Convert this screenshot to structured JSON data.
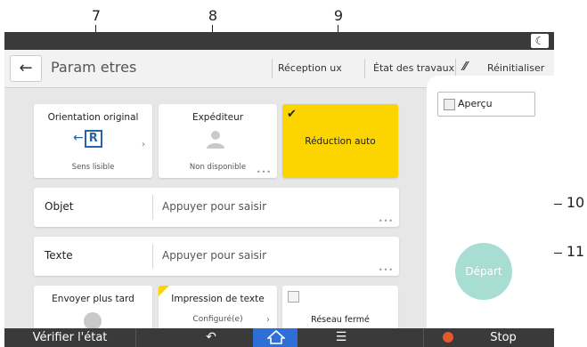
{
  "callouts": {
    "n7": "7",
    "n8": "8",
    "n9": "9",
    "n10": "10",
    "n11": "11"
  },
  "header": {
    "back_glyph": "←",
    "title": "Param etres",
    "reception": "Réception ux",
    "job_status": "État des travaux",
    "reset": "Réinitialiser"
  },
  "tiles": {
    "orientation": {
      "title": "Orientation original",
      "footer": "Sens lisible",
      "icon": "orientation-r-icon"
    },
    "sender": {
      "title": "Expéditeur",
      "footer": "Non disponible",
      "icon": "user-icon"
    },
    "reduction": {
      "label": "Réduction auto",
      "checked": true
    },
    "send_later": {
      "title": "Envoyer plus tard"
    },
    "print_text": {
      "title": "Impression de texte",
      "footer": "Configuré(e)"
    },
    "closed_network": {
      "title": "Réseau fermé"
    }
  },
  "fields": {
    "subject": {
      "label": "Objet",
      "value": "Appuyer pour saisir"
    },
    "text": {
      "label": "Texte",
      "value": "Appuyer pour saisir"
    }
  },
  "right_panel": {
    "preview": "Aperçu",
    "start": "Départ"
  },
  "bottom": {
    "check_status": "Vérifier l'état",
    "stop": "Stop"
  },
  "colors": {
    "accent_yellow": "#fcd500",
    "start_button": "#a8ddd4",
    "home_blue": "#2d6fd6"
  }
}
